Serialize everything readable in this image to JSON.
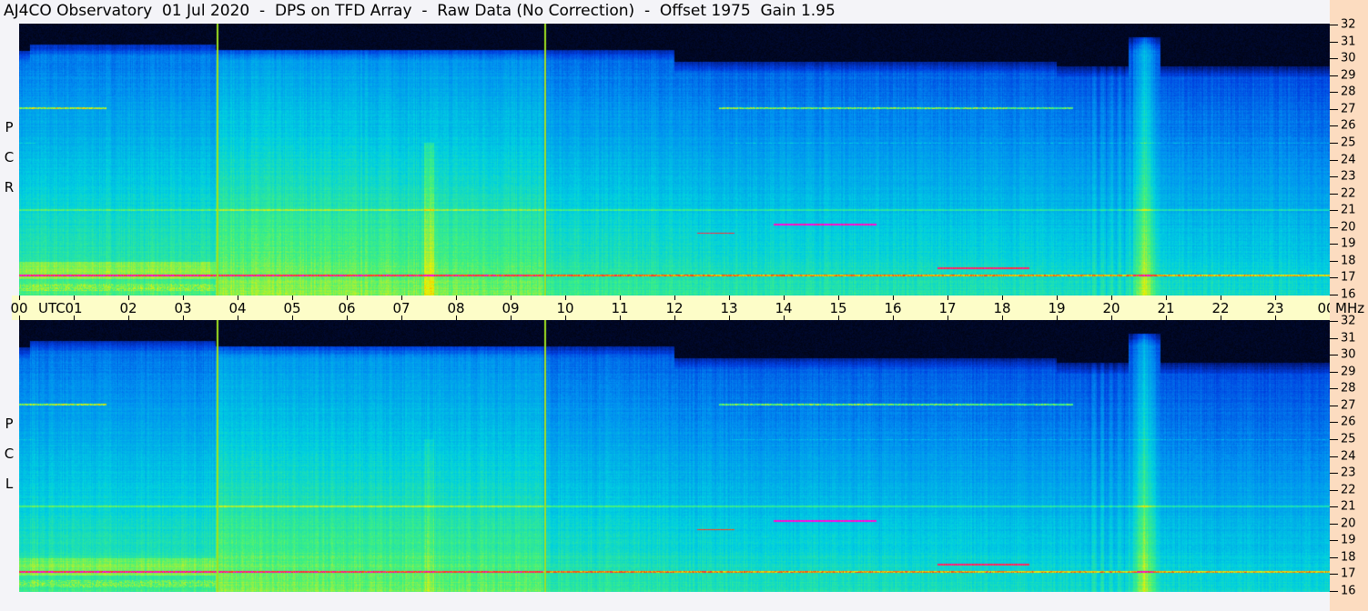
{
  "title": "AJ4CO Observatory  01 Jul 2020  -  DPS on TFD Array  -  Raw Data (No Correction)  -  Offset 1975  Gain 1.95",
  "panels": [
    {
      "label": [
        "R",
        "C",
        "P"
      ]
    },
    {
      "label": [
        "L",
        "C",
        "P"
      ]
    }
  ],
  "time_axis": {
    "unit_label": "UTC",
    "ticks": [
      "00",
      "01",
      "02",
      "03",
      "04",
      "05",
      "06",
      "07",
      "08",
      "09",
      "10",
      "11",
      "12",
      "13",
      "14",
      "15",
      "16",
      "17",
      "18",
      "19",
      "20",
      "21",
      "22",
      "23",
      "00"
    ]
  },
  "freq_axis": {
    "unit_label": "MHz",
    "ticks": [
      "16",
      "17",
      "18",
      "19",
      "20",
      "21",
      "22",
      "23",
      "24",
      "25",
      "26",
      "27",
      "28",
      "29",
      "30",
      "31",
      "32"
    ]
  },
  "chart_data": {
    "type": "heatmap",
    "title": "AJ4CO Observatory  01 Jul 2020  -  DPS on TFD Array  -  Raw Data (No Correction)  -  Offset 1975  Gain 1.95",
    "xlabel": "UTC",
    "ylabel": "MHz",
    "xlim": [
      0,
      24
    ],
    "ylim": [
      16,
      32
    ],
    "series": [
      {
        "name": "RCP"
      },
      {
        "name": "LCP"
      }
    ],
    "markers_utc_hours": [
      3.62,
      9.62
    ],
    "marker_color": "#a0e020",
    "colormap": [
      "#000000",
      "#001a80",
      "#0040e0",
      "#0090f0",
      "#00d0e0",
      "#40f080",
      "#f0f000",
      "#ff4000",
      "#ff00ff"
    ],
    "grid": false
  }
}
